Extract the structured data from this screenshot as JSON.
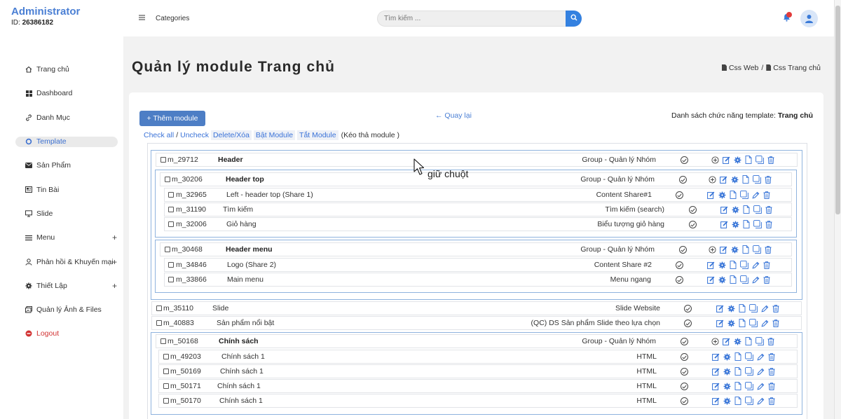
{
  "brand": {
    "title": "Administrator",
    "id_label": "ID:",
    "id_value": "26386182"
  },
  "topbar": {
    "categories": "Categories",
    "search_placeholder": "Tìm kiếm ..."
  },
  "sidebar": {
    "items": [
      {
        "label": "Trang chủ",
        "icon": "home-icon"
      },
      {
        "label": "Dashboard",
        "icon": "grid-icon"
      },
      {
        "label": "Danh Mục",
        "icon": "link-icon"
      },
      {
        "label": "Template",
        "icon": "circle-icon",
        "active": true
      },
      {
        "label": "Sản Phẩm",
        "icon": "envelope-icon"
      },
      {
        "label": "Tin Bài",
        "icon": "news-icon"
      },
      {
        "label": "Slide",
        "icon": "monitor-icon"
      },
      {
        "label": "Menu",
        "icon": "menu-icon",
        "expand": "+"
      },
      {
        "label": "Phản hồi & Khuyến mại",
        "icon": "user-icon",
        "expand": "+"
      },
      {
        "label": "Thiết Lập",
        "icon": "gear-icon",
        "expand": "+"
      },
      {
        "label": "Quản lý Ảnh & Files",
        "icon": "images-icon"
      },
      {
        "label": "Logout",
        "icon": "power-icon"
      }
    ]
  },
  "page": {
    "title": "Quản lý module Trang chủ",
    "breadcrumb": [
      "Css Web",
      "/",
      "Css Trang chủ"
    ],
    "add_module": "+ Thêm module",
    "back": "← Quay lại",
    "template_list_label": "Danh sách chức năng template:",
    "template_list_value": "Trang chủ",
    "actions": {
      "check_all": "Check all",
      "slash": "/",
      "uncheck": "Uncheck",
      "delete": "Delete/Xóa",
      "enable": "Bật Module",
      "disable": "Tắt Module",
      "drag_hint": "(Kéo thả module )"
    }
  },
  "modules": [
    {
      "id": "m_29712",
      "name": "Header",
      "type": "Group - Quản lý Nhóm",
      "bold": true
    },
    {
      "id": "m_30206",
      "name": "Header top",
      "type": "Group - Quản lý Nhóm",
      "bold": true
    },
    {
      "id": "m_32965",
      "name": "Left - header top (Share 1)",
      "type": "Content Share#1"
    },
    {
      "id": "m_31190",
      "name": "Tìm kiếm",
      "type": "Tìm kiếm (search)"
    },
    {
      "id": "m_32006",
      "name": "Giỏ hàng",
      "type": "Biểu tượng giỏ hàng"
    },
    {
      "id": "m_30468",
      "name": "Header menu",
      "type": "Group - Quản lý Nhóm",
      "bold": true
    },
    {
      "id": "m_34846",
      "name": "Logo (Share 2)",
      "type": "Content Share #2"
    },
    {
      "id": "m_33866",
      "name": "Main menu",
      "type": "Menu ngang"
    },
    {
      "id": "m_35110",
      "name": "Slide",
      "type": "Slide Website"
    },
    {
      "id": "m_40883",
      "name": "Sản phẩm nổi bật",
      "type": "(QC) DS Sản phẩm Slide theo lựa chọn"
    },
    {
      "id": "m_50168",
      "name": "Chính sách",
      "type": "Group - Quản lý Nhóm",
      "bold": true
    },
    {
      "id": "m_49203",
      "name": "Chính sách 1",
      "type": "HTML"
    },
    {
      "id": "m_50169",
      "name": "Chính sách 1",
      "type": "HTML"
    },
    {
      "id": "m_50171",
      "name": "Chính sách 1",
      "type": "HTML"
    },
    {
      "id": "m_50170",
      "name": "Chính sách 1",
      "type": "HTML"
    }
  ],
  "overlay": {
    "cursor_label": "giữ chuột"
  },
  "colors": {
    "brand": "#4a7fd4",
    "primary_button": "#4d7ec5",
    "search_button": "#3481e0",
    "icon_blue": "#2f6fd6",
    "logout": "#d23434",
    "notify": "#e23b3b"
  }
}
